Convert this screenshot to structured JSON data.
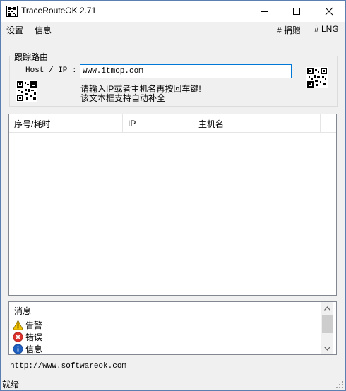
{
  "window": {
    "title": "TraceRouteOK 2.71",
    "icons": {
      "app": "app-icon",
      "minimize": "minimize-icon",
      "maximize": "maximize-icon",
      "close": "close-icon"
    }
  },
  "menu": {
    "settings": "设置",
    "info": "信息",
    "donate": "# 捐赠",
    "lng": "# LNG"
  },
  "trace": {
    "group_label": "跟踪路由",
    "host_label": "Host / IP :",
    "host_value": "www.itmop.com",
    "hint_line1": "请输入IP或者主机名再按回车键!",
    "hint_line2": "该文本框支持自动补全"
  },
  "results": {
    "columns": [
      "序号/耗时",
      "IP",
      "主机名"
    ],
    "rows": []
  },
  "messages": {
    "header": "消息",
    "items": [
      {
        "icon": "warning-icon",
        "label": "告警"
      },
      {
        "icon": "error-icon",
        "label": "错误"
      },
      {
        "icon": "info-icon",
        "label": "信息"
      }
    ]
  },
  "footer": {
    "url": "http://www.softwareok.com"
  },
  "status": {
    "text": "就绪"
  },
  "colors": {
    "accent": "#0078d7",
    "warning": "#f5c400",
    "error": "#d9312b",
    "info": "#1f5fbf"
  }
}
